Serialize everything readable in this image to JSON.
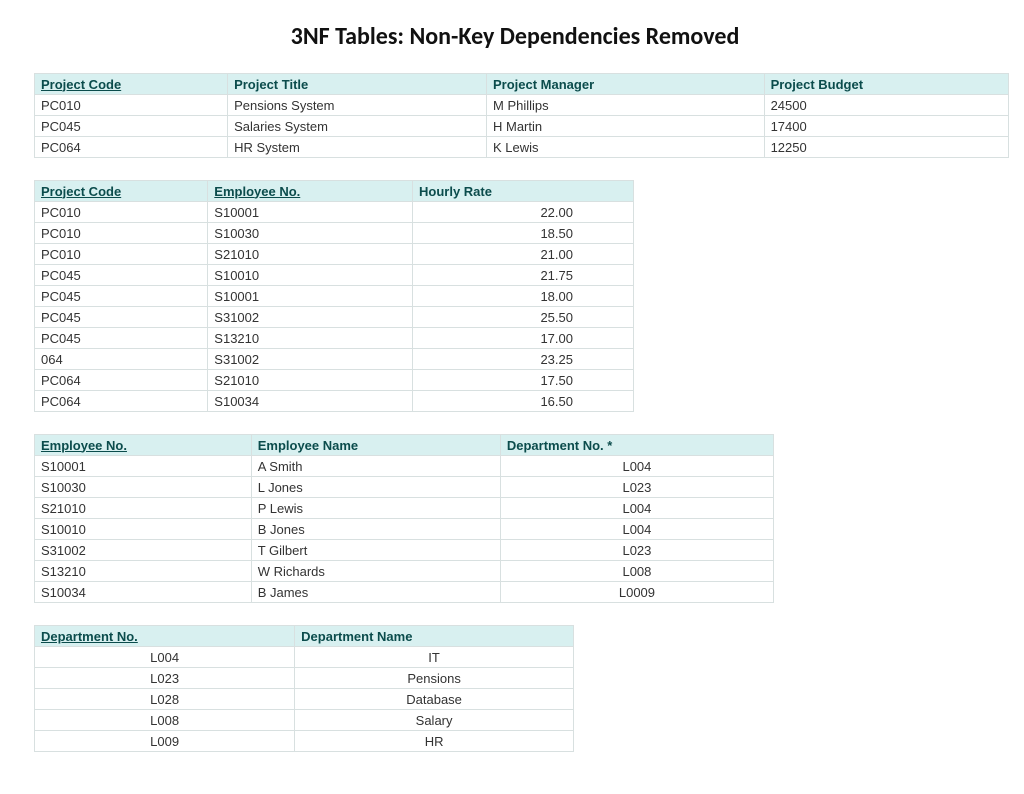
{
  "title": "3NF Tables: Non-Key Dependencies Removed",
  "tables": {
    "projects": {
      "headers": [
        "Project Code",
        "Project Title",
        "Project Manager",
        "Project Budget"
      ],
      "pk_cols": [
        0
      ],
      "rows": [
        [
          "PC010",
          "Pensions System",
          "M Phillips",
          "24500"
        ],
        [
          "PC045",
          "Salaries System",
          "H Martin",
          "17400"
        ],
        [
          "PC064",
          "HR System",
          "K Lewis",
          "12250"
        ]
      ]
    },
    "assignments": {
      "headers": [
        "Project Code",
        "Employee No.",
        "Hourly Rate"
      ],
      "pk_cols": [
        0,
        1
      ],
      "rows": [
        [
          "PC010",
          "S10001",
          "22.00"
        ],
        [
          "PC010",
          "S10030",
          "18.50"
        ],
        [
          "PC010",
          "S21010",
          "21.00"
        ],
        [
          "PC045",
          "S10010",
          "21.75"
        ],
        [
          "PC045",
          "S10001",
          "18.00"
        ],
        [
          "PC045",
          "S31002",
          "25.50"
        ],
        [
          "PC045",
          "S13210",
          "17.00"
        ],
        [
          "064",
          "S31002",
          "23.25"
        ],
        [
          "PC064",
          "S21010",
          "17.50"
        ],
        [
          "PC064",
          "S10034",
          "16.50"
        ]
      ]
    },
    "employees": {
      "headers": [
        "Employee No.",
        "Employee Name",
        "Department No. *"
      ],
      "pk_cols": [
        0
      ],
      "rows": [
        [
          "S10001",
          "A Smith",
          "L004"
        ],
        [
          "S10030",
          "L Jones",
          "L023"
        ],
        [
          "S21010",
          "P Lewis",
          "L004"
        ],
        [
          "S10010",
          "B Jones",
          "L004"
        ],
        [
          "S31002",
          "T Gilbert",
          "L023"
        ],
        [
          "S13210",
          "W Richards",
          "L008"
        ],
        [
          "S10034",
          "B James",
          "L0009"
        ]
      ]
    },
    "departments": {
      "headers": [
        "Department No.",
        "Department Name"
      ],
      "pk_cols": [
        0
      ],
      "rows": [
        [
          "L004",
          "IT"
        ],
        [
          "L023",
          "Pensions"
        ],
        [
          "L028",
          "Database"
        ],
        [
          "L008",
          "Salary"
        ],
        [
          "L009",
          "HR"
        ]
      ]
    }
  }
}
